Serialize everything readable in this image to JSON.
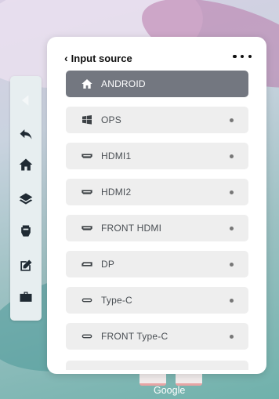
{
  "panel": {
    "title": "Input source",
    "back_icon": "chevron-left-icon",
    "more_icon": "more-horizontal-icon"
  },
  "sources": [
    {
      "label": "ANDROID",
      "icon": "home-icon",
      "active": true
    },
    {
      "label": "OPS",
      "icon": "windows-icon",
      "active": false
    },
    {
      "label": "HDMI1",
      "icon": "hdmi-port-icon",
      "active": false
    },
    {
      "label": "HDMI2",
      "icon": "hdmi-port-icon",
      "active": false
    },
    {
      "label": "FRONT HDMI",
      "icon": "hdmi-port-icon",
      "active": false
    },
    {
      "label": "DP",
      "icon": "displayport-icon",
      "active": false
    },
    {
      "label": "Type-C",
      "icon": "usb-c-icon",
      "active": false
    },
    {
      "label": "FRONT Type-C",
      "icon": "usb-c-icon",
      "active": false
    }
  ],
  "side_toolbar": {
    "items": [
      "collapse-arrow-icon",
      "back-icon",
      "home-icon",
      "layers-icon",
      "input-source-icon",
      "annotate-icon",
      "toolbox-icon"
    ]
  },
  "dock": {
    "label": "Google"
  },
  "colors": {
    "active_item": "#737780",
    "item_bg": "#eeeeee",
    "panel_bg": "#ffffff"
  }
}
